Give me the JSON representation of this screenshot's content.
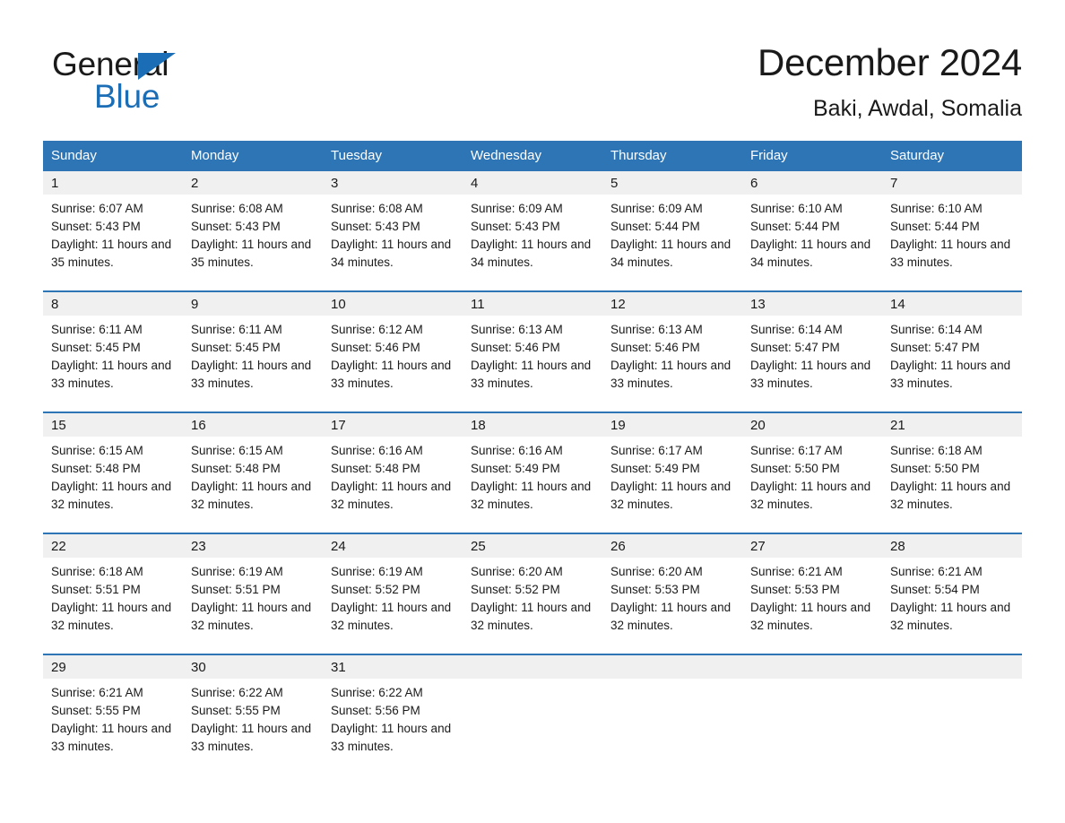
{
  "logo": {
    "word_one": "General",
    "word_two": "Blue",
    "triangle_color": "#1b6eb5",
    "icon": "triangle-logo-icon"
  },
  "header": {
    "title": "December 2024",
    "subtitle": "Baki, Awdal, Somalia",
    "accent_color": "#2e75b6",
    "daynum_band_color": "#f0f0f0"
  },
  "weekday_headers": [
    "Sunday",
    "Monday",
    "Tuesday",
    "Wednesday",
    "Thursday",
    "Friday",
    "Saturday"
  ],
  "labels": {
    "sunrise_prefix": "Sunrise:",
    "sunset_prefix": "Sunset:",
    "daylight_prefix": "Daylight:"
  },
  "weeks": [
    [
      {
        "day": "1",
        "sunrise": "Sunrise: 6:07 AM",
        "sunset": "Sunset: 5:43 PM",
        "daylight": "Daylight: 11 hours and 35 minutes."
      },
      {
        "day": "2",
        "sunrise": "Sunrise: 6:08 AM",
        "sunset": "Sunset: 5:43 PM",
        "daylight": "Daylight: 11 hours and 35 minutes."
      },
      {
        "day": "3",
        "sunrise": "Sunrise: 6:08 AM",
        "sunset": "Sunset: 5:43 PM",
        "daylight": "Daylight: 11 hours and 34 minutes."
      },
      {
        "day": "4",
        "sunrise": "Sunrise: 6:09 AM",
        "sunset": "Sunset: 5:43 PM",
        "daylight": "Daylight: 11 hours and 34 minutes."
      },
      {
        "day": "5",
        "sunrise": "Sunrise: 6:09 AM",
        "sunset": "Sunset: 5:44 PM",
        "daylight": "Daylight: 11 hours and 34 minutes."
      },
      {
        "day": "6",
        "sunrise": "Sunrise: 6:10 AM",
        "sunset": "Sunset: 5:44 PM",
        "daylight": "Daylight: 11 hours and 34 minutes."
      },
      {
        "day": "7",
        "sunrise": "Sunrise: 6:10 AM",
        "sunset": "Sunset: 5:44 PM",
        "daylight": "Daylight: 11 hours and 33 minutes."
      }
    ],
    [
      {
        "day": "8",
        "sunrise": "Sunrise: 6:11 AM",
        "sunset": "Sunset: 5:45 PM",
        "daylight": "Daylight: 11 hours and 33 minutes."
      },
      {
        "day": "9",
        "sunrise": "Sunrise: 6:11 AM",
        "sunset": "Sunset: 5:45 PM",
        "daylight": "Daylight: 11 hours and 33 minutes."
      },
      {
        "day": "10",
        "sunrise": "Sunrise: 6:12 AM",
        "sunset": "Sunset: 5:46 PM",
        "daylight": "Daylight: 11 hours and 33 minutes."
      },
      {
        "day": "11",
        "sunrise": "Sunrise: 6:13 AM",
        "sunset": "Sunset: 5:46 PM",
        "daylight": "Daylight: 11 hours and 33 minutes."
      },
      {
        "day": "12",
        "sunrise": "Sunrise: 6:13 AM",
        "sunset": "Sunset: 5:46 PM",
        "daylight": "Daylight: 11 hours and 33 minutes."
      },
      {
        "day": "13",
        "sunrise": "Sunrise: 6:14 AM",
        "sunset": "Sunset: 5:47 PM",
        "daylight": "Daylight: 11 hours and 33 minutes."
      },
      {
        "day": "14",
        "sunrise": "Sunrise: 6:14 AM",
        "sunset": "Sunset: 5:47 PM",
        "daylight": "Daylight: 11 hours and 33 minutes."
      }
    ],
    [
      {
        "day": "15",
        "sunrise": "Sunrise: 6:15 AM",
        "sunset": "Sunset: 5:48 PM",
        "daylight": "Daylight: 11 hours and 32 minutes."
      },
      {
        "day": "16",
        "sunrise": "Sunrise: 6:15 AM",
        "sunset": "Sunset: 5:48 PM",
        "daylight": "Daylight: 11 hours and 32 minutes."
      },
      {
        "day": "17",
        "sunrise": "Sunrise: 6:16 AM",
        "sunset": "Sunset: 5:48 PM",
        "daylight": "Daylight: 11 hours and 32 minutes."
      },
      {
        "day": "18",
        "sunrise": "Sunrise: 6:16 AM",
        "sunset": "Sunset: 5:49 PM",
        "daylight": "Daylight: 11 hours and 32 minutes."
      },
      {
        "day": "19",
        "sunrise": "Sunrise: 6:17 AM",
        "sunset": "Sunset: 5:49 PM",
        "daylight": "Daylight: 11 hours and 32 minutes."
      },
      {
        "day": "20",
        "sunrise": "Sunrise: 6:17 AM",
        "sunset": "Sunset: 5:50 PM",
        "daylight": "Daylight: 11 hours and 32 minutes."
      },
      {
        "day": "21",
        "sunrise": "Sunrise: 6:18 AM",
        "sunset": "Sunset: 5:50 PM",
        "daylight": "Daylight: 11 hours and 32 minutes."
      }
    ],
    [
      {
        "day": "22",
        "sunrise": "Sunrise: 6:18 AM",
        "sunset": "Sunset: 5:51 PM",
        "daylight": "Daylight: 11 hours and 32 minutes."
      },
      {
        "day": "23",
        "sunrise": "Sunrise: 6:19 AM",
        "sunset": "Sunset: 5:51 PM",
        "daylight": "Daylight: 11 hours and 32 minutes."
      },
      {
        "day": "24",
        "sunrise": "Sunrise: 6:19 AM",
        "sunset": "Sunset: 5:52 PM",
        "daylight": "Daylight: 11 hours and 32 minutes."
      },
      {
        "day": "25",
        "sunrise": "Sunrise: 6:20 AM",
        "sunset": "Sunset: 5:52 PM",
        "daylight": "Daylight: 11 hours and 32 minutes."
      },
      {
        "day": "26",
        "sunrise": "Sunrise: 6:20 AM",
        "sunset": "Sunset: 5:53 PM",
        "daylight": "Daylight: 11 hours and 32 minutes."
      },
      {
        "day": "27",
        "sunrise": "Sunrise: 6:21 AM",
        "sunset": "Sunset: 5:53 PM",
        "daylight": "Daylight: 11 hours and 32 minutes."
      },
      {
        "day": "28",
        "sunrise": "Sunrise: 6:21 AM",
        "sunset": "Sunset: 5:54 PM",
        "daylight": "Daylight: 11 hours and 32 minutes."
      }
    ],
    [
      {
        "day": "29",
        "sunrise": "Sunrise: 6:21 AM",
        "sunset": "Sunset: 5:55 PM",
        "daylight": "Daylight: 11 hours and 33 minutes."
      },
      {
        "day": "30",
        "sunrise": "Sunrise: 6:22 AM",
        "sunset": "Sunset: 5:55 PM",
        "daylight": "Daylight: 11 hours and 33 minutes."
      },
      {
        "day": "31",
        "sunrise": "Sunrise: 6:22 AM",
        "sunset": "Sunset: 5:56 PM",
        "daylight": "Daylight: 11 hours and 33 minutes."
      },
      {
        "day": "",
        "sunrise": "",
        "sunset": "",
        "daylight": ""
      },
      {
        "day": "",
        "sunrise": "",
        "sunset": "",
        "daylight": ""
      },
      {
        "day": "",
        "sunrise": "",
        "sunset": "",
        "daylight": ""
      },
      {
        "day": "",
        "sunrise": "",
        "sunset": "",
        "daylight": ""
      }
    ]
  ]
}
